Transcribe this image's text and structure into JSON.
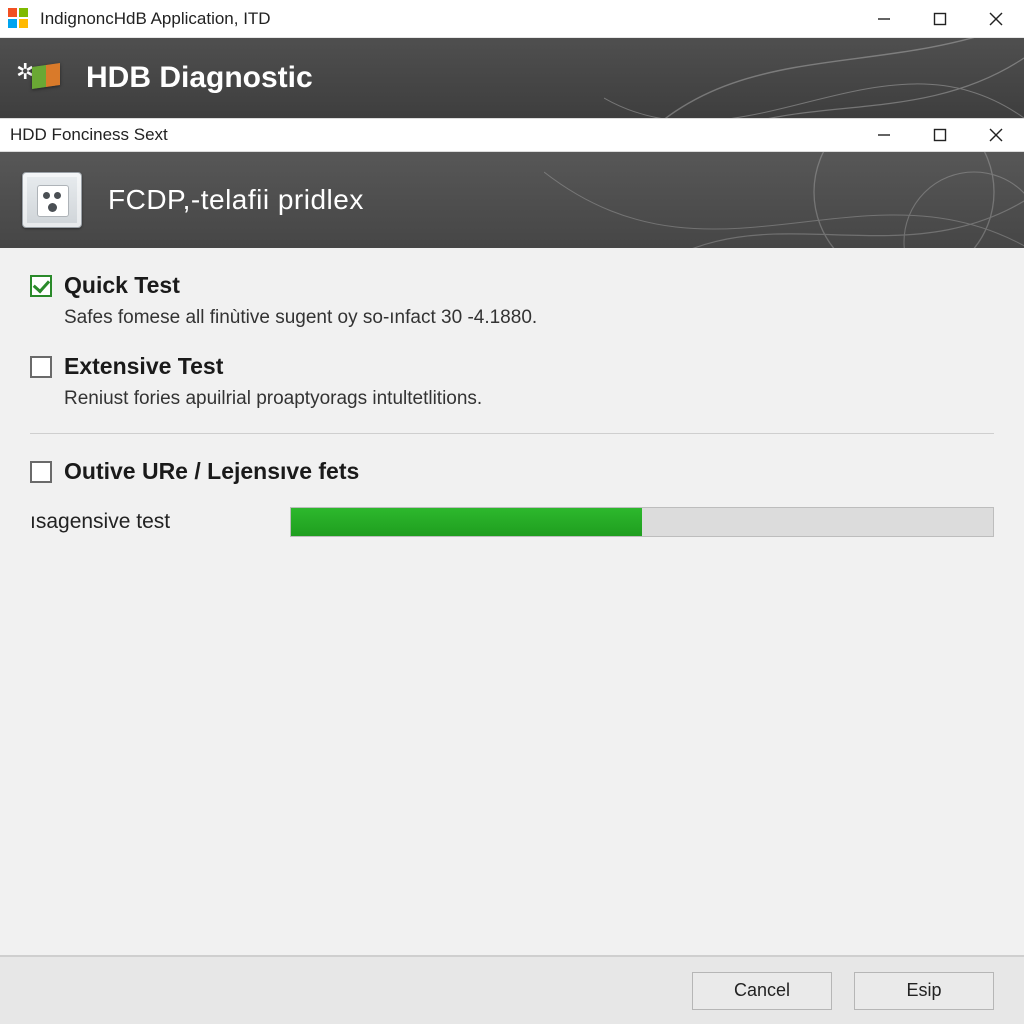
{
  "outer_window": {
    "title": "IndignoncHdB Application, ITD"
  },
  "banner": {
    "title": "HDB Diagnostic"
  },
  "inner_window": {
    "title": "HDD Fonciness Sext"
  },
  "subheader": {
    "title": "FCDP,-telafii pridlex"
  },
  "options": [
    {
      "checked": true,
      "title": "Quick Test",
      "description": "Safes fomese all finùtive sugent oy so-ınfact 30 -4.1880."
    },
    {
      "checked": false,
      "title": "Extensive Test",
      "description": "Reniust fories apuilrial proaptyorags intultetlitions."
    }
  ],
  "extra_option": {
    "checked": false,
    "title": "Outive URe / Lejensıve fets"
  },
  "progress": {
    "label": "ısagensive test",
    "percent": 50
  },
  "footer": {
    "cancel": "Cancel",
    "skip": "Esip"
  },
  "colors": {
    "progress_fill": "#22a322",
    "banner_bg": "#474747"
  }
}
